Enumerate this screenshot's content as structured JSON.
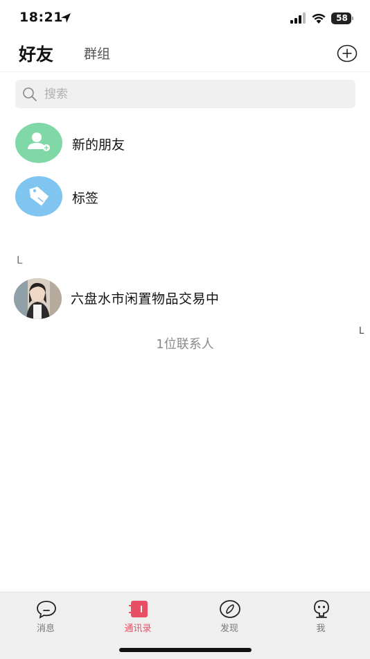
{
  "status_bar": {
    "time": "18:21",
    "battery_level": "58",
    "icons": [
      "location-arrow-icon",
      "cellular-signal-icon",
      "wifi-icon",
      "battery-icon"
    ]
  },
  "header": {
    "tabs": [
      {
        "label": "好友",
        "active": true
      },
      {
        "label": "群组",
        "active": false
      }
    ],
    "add_icon": "plus-circle-icon"
  },
  "search": {
    "placeholder": "搜索",
    "value": "",
    "icon": "search-icon"
  },
  "functions": [
    {
      "label": "新的朋友",
      "icon": "add-user-icon",
      "color": "#7fd8a6"
    },
    {
      "label": "标签",
      "icon": "tag-icon",
      "color": "#7fc5ef"
    }
  ],
  "contacts": {
    "section_letter": "L",
    "index_letter": "L",
    "items": [
      {
        "name": "六盘水市闲置物品交易中"
      }
    ],
    "count_text": "1位联系人"
  },
  "tabbar": {
    "accent_color": "#e94f64",
    "items": [
      {
        "label": "消息",
        "icon": "chat-bubble-icon",
        "active": false
      },
      {
        "label": "通讯录",
        "icon": "address-book-icon",
        "active": true
      },
      {
        "label": "发现",
        "icon": "compass-icon",
        "active": false
      },
      {
        "label": "我",
        "icon": "profile-face-icon",
        "active": false
      }
    ]
  }
}
